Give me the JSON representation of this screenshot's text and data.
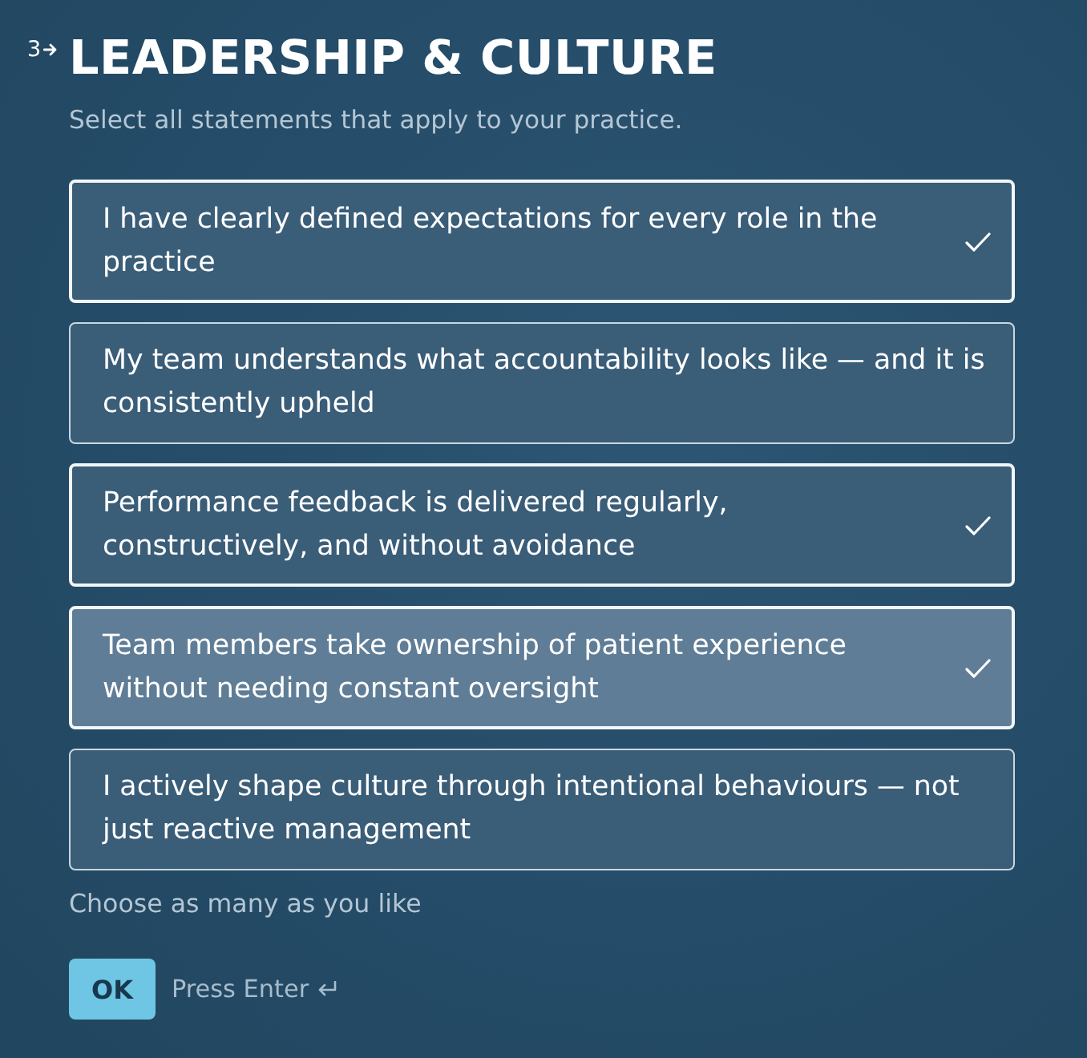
{
  "question": {
    "number": "3",
    "title": "LEADERSHIP & CULTURE",
    "subtitle": "Select all statements that apply to your practice."
  },
  "options": [
    {
      "text": "I have clearly defined expectations for every role in the practice",
      "selected": true,
      "hovered": false
    },
    {
      "text": "My team understands what accountability looks like — and it is consistently upheld",
      "selected": false,
      "hovered": false
    },
    {
      "text": "Performance feedback is delivered regularly, constructively, and without avoidance",
      "selected": true,
      "hovered": false
    },
    {
      "text": "Team members take ownership of patient experience without needing constant oversight",
      "selected": true,
      "hovered": true
    },
    {
      "text": "I actively shape culture through intentional behaviours — not just reactive management",
      "selected": false,
      "hovered": false
    }
  ],
  "hint": "Choose as many as you like",
  "submit": {
    "label": "OK",
    "shortcut": "Press Enter"
  }
}
